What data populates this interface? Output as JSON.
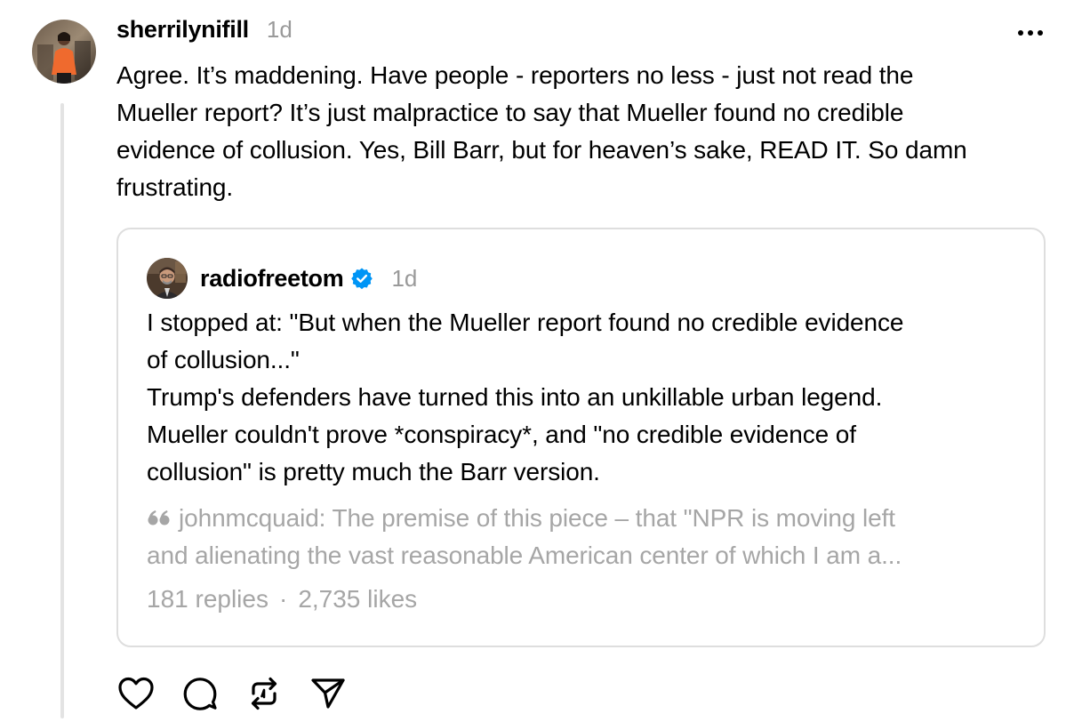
{
  "post": {
    "username": "sherrilynifill",
    "timestamp": "1d",
    "text": "Agree. It’s maddening. Have people - reporters no less - just not read the\nMueller report? It’s just malpractice to say that Mueller found no credible\nevidence of collusion. Yes, Bill Barr, but for heaven’s sake, READ IT. So damn\nfrustrating."
  },
  "quoted_post": {
    "username": "radiofreetom",
    "verified": true,
    "timestamp": "1d",
    "text": "I stopped at: \"But when the Mueller report found no credible evidence\nof collusion...\"\nTrump's defenders have turned this into an unkillable urban legend.\nMueller couldn't prove *conspiracy*, and \"no credible evidence of\ncollusion\" is pretty much the Barr version.",
    "nested_quote": {
      "line1": "johnmcquaid: The premise of this piece – that \"NPR is moving left",
      "line2": "and alienating the vast reasonable American center of which I am a..."
    },
    "replies": "181 replies",
    "separator": "·",
    "likes": "2,735 likes"
  },
  "icons": {
    "more": "more-options-icon",
    "verified": "verified-badge-icon",
    "quote": "quote-mark-icon",
    "like": "heart-icon",
    "reply": "comment-icon",
    "repost": "repost-icon",
    "share": "send-icon"
  },
  "colors": {
    "text": "#000000",
    "muted": "#9a9a9a",
    "border": "#dedede",
    "verified": "#0095f6",
    "thread_line": "#e3e3e3"
  }
}
